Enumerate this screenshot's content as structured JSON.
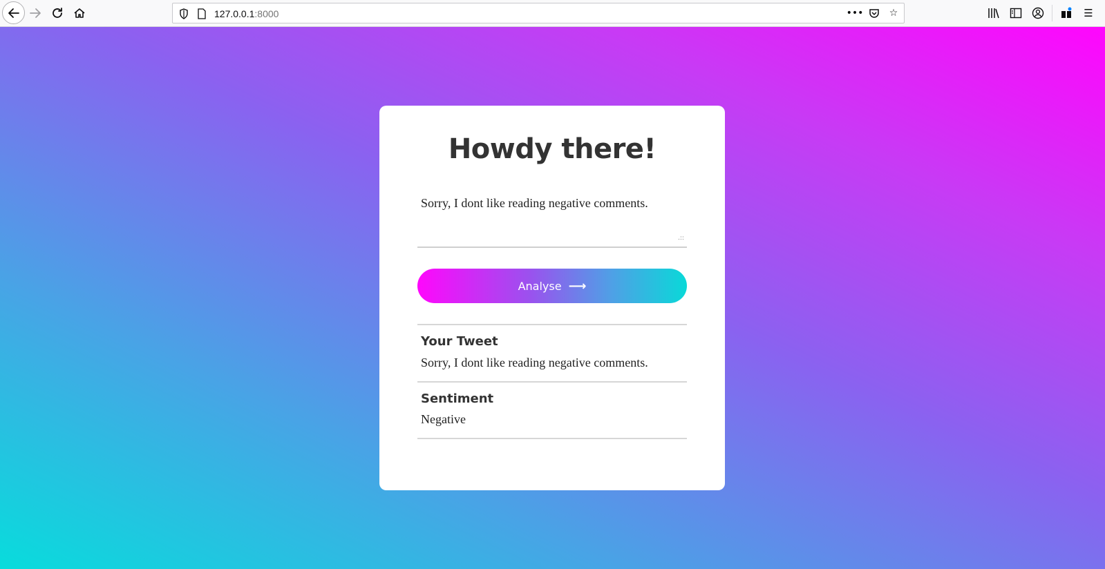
{
  "browser": {
    "url_host": "127.0.0.1",
    "url_port": ":8000",
    "icons": {
      "back": "back-arrow-icon",
      "forward": "forward-arrow-icon",
      "reload": "reload-icon",
      "home": "home-icon",
      "shield": "shield-icon",
      "page": "page-icon",
      "more": "ellipsis-icon",
      "pocket": "pocket-icon",
      "bookmark": "star-icon",
      "library": "library-icon",
      "sidebar": "sidebar-icon",
      "account": "account-icon",
      "gift": "gift-icon",
      "menu": "hamburger-menu-icon"
    }
  },
  "page": {
    "title": "Howdy there!",
    "input_value": "Sorry, I dont like reading negative comments.",
    "analyse_label": "Analyse",
    "your_tweet_label": "Your Tweet",
    "your_tweet_value": "Sorry, I dont like reading negative comments.",
    "sentiment_label": "Sentiment",
    "sentiment_value": "Negative",
    "colors": {
      "gradient_start": "#ff06fd",
      "gradient_end": "#08dcdc",
      "card": "#ffffff"
    }
  }
}
